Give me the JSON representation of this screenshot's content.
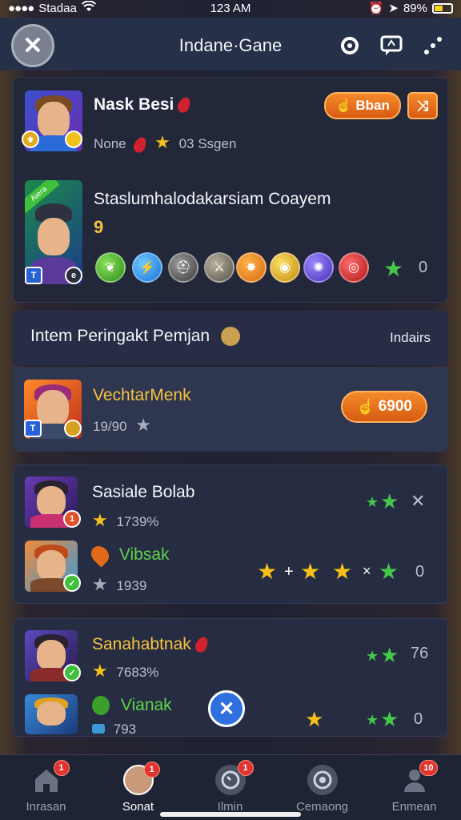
{
  "status_bar": {
    "carrier": "Stadaa",
    "time": "123 AM",
    "battery": "89%"
  },
  "header": {
    "title": "Indane·Gane",
    "close": "✕"
  },
  "profile": {
    "name": "Nask Besi",
    "rank_label": "None",
    "season": "03 Ssgen",
    "button": "Bban",
    "card_title": "Staslumhalodakarsiam Coayem",
    "card_level": "9",
    "card_tag": "Aiera",
    "score": "0"
  },
  "section": {
    "title": "Intem Peringakt Pemjan",
    "link": "Indairs"
  },
  "featured": {
    "name": "VechtarMenk",
    "sub": "19/90",
    "button": "6900"
  },
  "entries": [
    {
      "name": "Sasiale Bolab",
      "sub": "1739%",
      "trail": "✕",
      "name_color": "white"
    },
    {
      "name": "Vibsak",
      "sub": "1939",
      "trail": "0",
      "name_color": "green"
    },
    {
      "name": "Sanahabtnak",
      "sub": "7683%",
      "trail": "76",
      "name_color": "gold"
    },
    {
      "name": "Vianak",
      "sub": "793",
      "trail": "0",
      "name_color": "green"
    }
  ],
  "nav": [
    {
      "label": "Inrasan",
      "badge": "1",
      "icon": "home-icon"
    },
    {
      "label": "Sonat",
      "badge": "1",
      "icon": "avatar-icon"
    },
    {
      "label": "Ilmin",
      "badge": "1",
      "icon": "timer-icon"
    },
    {
      "label": "Cemaong",
      "badge": "",
      "icon": "target-icon"
    },
    {
      "label": "Enmean",
      "badge": "10",
      "icon": "user-icon"
    }
  ],
  "colors": {
    "accent": "#f58a2a",
    "bg": "#22283a",
    "gold": "#f6c23e",
    "green": "#5fd34a"
  }
}
